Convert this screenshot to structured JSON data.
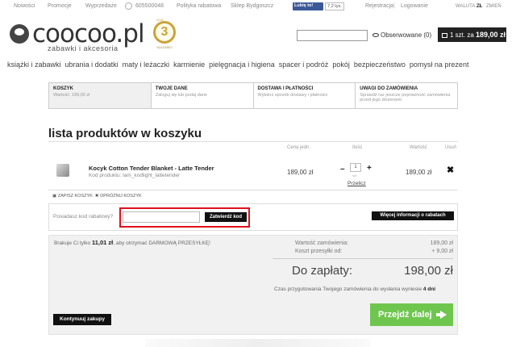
{
  "topbar": {
    "links": [
      "Nowości",
      "Promocje",
      "Wyprzedaże"
    ],
    "phone": "605500048",
    "policy": "Polityka rabatowa",
    "store": "Sklep Bydgoszcz",
    "fb_like": "Lubię to!",
    "fb_count": "7,2 tys.",
    "register": "Rejestracja",
    "login": "Logowanie",
    "currency_label": "WALUTA:",
    "currency": "ZŁ",
    "change": "ZMIEŃ"
  },
  "header": {
    "logo_text": "coocoo.pl",
    "logo_sub": "zabawki i akcesoria",
    "award_number": "3",
    "award_top": "2022",
    "award_ribbon": "DLA DZIECI",
    "observed": "Obserwowane (0)",
    "cart": "1 szt. za",
    "cart_total": "189,00 zł"
  },
  "nav": [
    "książki i zabawki",
    "ubrania i dodatki",
    "maty i leżaczki",
    "karmienie",
    "pielęgnacja i higiena",
    "spacer i podróż",
    "pokój",
    "bezpieczeństwo",
    "pomysł na prezent"
  ],
  "steps": [
    {
      "title": "KOSZYK",
      "desc": "Wartość: 189,00 zł"
    },
    {
      "title": "TWOJE DANE",
      "desc": "Zaloguj się lub podaj dane"
    },
    {
      "title": "DOSTAWA I PŁATNOŚCI",
      "desc": "Wybierz sposób dostawy i płatności"
    },
    {
      "title": "UWAGI DO ZAMÓWIENIA",
      "desc": "Sprawdź raz jeszcze poprawność zamówienia przed jego złożeniem"
    }
  ],
  "list_title": "lista produktów w koszyku",
  "columns": {
    "unit_price": "Cena jedn.",
    "qty": "Ilość",
    "value": "Wartość",
    "remove": "Usuń"
  },
  "product": {
    "name": "Kocyk Cotton Tender Blanket - Latte Tender",
    "code": "Kod produktu: lam_kodlight_lattetender",
    "unit_price": "189,00 zł",
    "qty": "1",
    "unit": "szt.",
    "recalc": "Przelicz",
    "value": "189,00 zł"
  },
  "cart_actions": {
    "save": "ZAPISZ KOSZYK",
    "empty": "OPRÓŻNIJ KOSZYK"
  },
  "coupon": {
    "label": "Posiadasz kod rabatowy?",
    "input_value": "",
    "submit": "Zatwierdź kod",
    "more_info": "Więcej informacji o rabatach"
  },
  "summary": {
    "free_shipping_prefix": "Brakuje Ci tylko",
    "free_shipping_amount": "11,01 zł",
    "free_shipping_suffix": ", aby otrzymać DARMOWĄ PRZESYŁKĘ!",
    "order_value_label": "Wartość zamówienia:",
    "order_value": "189,00 zł",
    "shipping_label": "Koszt przesyłki od:",
    "shipping_value": "+ 9,00 zł",
    "to_pay_label": "Do zapłaty:",
    "to_pay_value": "198,00 zł",
    "prep_text": "Czas przygotowania Twojego zamówienia do wysłania wyniesie",
    "prep_days": "4 dni",
    "continue": "Kontynuuj zakupy",
    "next": "Przejdź dalej"
  }
}
